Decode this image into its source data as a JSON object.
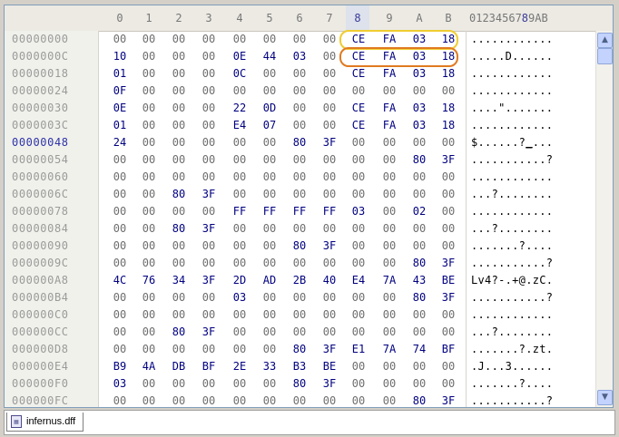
{
  "columns": [
    "0",
    "1",
    "2",
    "3",
    "4",
    "5",
    "6",
    "7",
    "8",
    "9",
    "A",
    "B"
  ],
  "ascii_header_pre": "01234567",
  "ascii_header_hl": "8",
  "ascii_header_post": "9AB",
  "selected_column": "8",
  "current_address": "00000048",
  "rows": [
    {
      "addr": "00000000",
      "bytes": [
        "00",
        "00",
        "00",
        "00",
        "00",
        "00",
        "00",
        "00",
        "CE",
        "FA",
        "03",
        "18"
      ],
      "ascii": "............"
    },
    {
      "addr": "0000000C",
      "bytes": [
        "10",
        "00",
        "00",
        "00",
        "0E",
        "44",
        "03",
        "00",
        "CE",
        "FA",
        "03",
        "18"
      ],
      "ascii": ".....D......"
    },
    {
      "addr": "00000018",
      "bytes": [
        "01",
        "00",
        "00",
        "00",
        "0C",
        "00",
        "00",
        "00",
        "CE",
        "FA",
        "03",
        "18"
      ],
      "ascii": "............"
    },
    {
      "addr": "00000024",
      "bytes": [
        "0F",
        "00",
        "00",
        "00",
        "00",
        "00",
        "00",
        "00",
        "00",
        "00",
        "00",
        "00"
      ],
      "ascii": "............"
    },
    {
      "addr": "00000030",
      "bytes": [
        "0E",
        "00",
        "00",
        "00",
        "22",
        "0D",
        "00",
        "00",
        "CE",
        "FA",
        "03",
        "18"
      ],
      "ascii": "....\"......."
    },
    {
      "addr": "0000003C",
      "bytes": [
        "01",
        "00",
        "00",
        "00",
        "E4",
        "07",
        "00",
        "00",
        "CE",
        "FA",
        "03",
        "18"
      ],
      "ascii": "............"
    },
    {
      "addr": "00000048",
      "bytes": [
        "24",
        "00",
        "00",
        "00",
        "00",
        "00",
        "80",
        "3F",
        "00",
        "00",
        "00",
        "00"
      ],
      "ascii": "$......?",
      "ascii_caret": "_",
      "ascii_post": "..."
    },
    {
      "addr": "00000054",
      "bytes": [
        "00",
        "00",
        "00",
        "00",
        "00",
        "00",
        "00",
        "00",
        "00",
        "00",
        "80",
        "3F"
      ],
      "ascii": "...........?"
    },
    {
      "addr": "00000060",
      "bytes": [
        "00",
        "00",
        "00",
        "00",
        "00",
        "00",
        "00",
        "00",
        "00",
        "00",
        "00",
        "00"
      ],
      "ascii": "............"
    },
    {
      "addr": "0000006C",
      "bytes": [
        "00",
        "00",
        "80",
        "3F",
        "00",
        "00",
        "00",
        "00",
        "00",
        "00",
        "00",
        "00"
      ],
      "ascii": "...?........"
    },
    {
      "addr": "00000078",
      "bytes": [
        "00",
        "00",
        "00",
        "00",
        "FF",
        "FF",
        "FF",
        "FF",
        "03",
        "00",
        "02",
        "00"
      ],
      "ascii": "............"
    },
    {
      "addr": "00000084",
      "bytes": [
        "00",
        "00",
        "80",
        "3F",
        "00",
        "00",
        "00",
        "00",
        "00",
        "00",
        "00",
        "00"
      ],
      "ascii": "...?........"
    },
    {
      "addr": "00000090",
      "bytes": [
        "00",
        "00",
        "00",
        "00",
        "00",
        "00",
        "80",
        "3F",
        "00",
        "00",
        "00",
        "00"
      ],
      "ascii": ".......?...."
    },
    {
      "addr": "0000009C",
      "bytes": [
        "00",
        "00",
        "00",
        "00",
        "00",
        "00",
        "00",
        "00",
        "00",
        "00",
        "80",
        "3F"
      ],
      "ascii": "...........?"
    },
    {
      "addr": "000000A8",
      "bytes": [
        "4C",
        "76",
        "34",
        "3F",
        "2D",
        "AD",
        "2B",
        "40",
        "E4",
        "7A",
        "43",
        "BE"
      ],
      "ascii": "Lv4?-.+@.zC."
    },
    {
      "addr": "000000B4",
      "bytes": [
        "00",
        "00",
        "00",
        "00",
        "03",
        "00",
        "00",
        "00",
        "00",
        "00",
        "80",
        "3F"
      ],
      "ascii": "...........?"
    },
    {
      "addr": "000000C0",
      "bytes": [
        "00",
        "00",
        "00",
        "00",
        "00",
        "00",
        "00",
        "00",
        "00",
        "00",
        "00",
        "00"
      ],
      "ascii": "............"
    },
    {
      "addr": "000000CC",
      "bytes": [
        "00",
        "00",
        "80",
        "3F",
        "00",
        "00",
        "00",
        "00",
        "00",
        "00",
        "00",
        "00"
      ],
      "ascii": "...?........"
    },
    {
      "addr": "000000D8",
      "bytes": [
        "00",
        "00",
        "00",
        "00",
        "00",
        "00",
        "80",
        "3F",
        "E1",
        "7A",
        "74",
        "BF"
      ],
      "ascii": ".......?.zt."
    },
    {
      "addr": "000000E4",
      "bytes": [
        "B9",
        "4A",
        "DB",
        "BF",
        "2E",
        "33",
        "B3",
        "BE",
        "00",
        "00",
        "00",
        "00"
      ],
      "ascii": ".J...3......"
    },
    {
      "addr": "000000F0",
      "bytes": [
        "03",
        "00",
        "00",
        "00",
        "00",
        "00",
        "80",
        "3F",
        "00",
        "00",
        "00",
        "00"
      ],
      "ascii": ".......?...."
    },
    {
      "addr": "000000FC",
      "bytes": [
        "00",
        "00",
        "00",
        "00",
        "00",
        "00",
        "00",
        "00",
        "00",
        "00",
        "80",
        "3F"
      ],
      "ascii": "...........?"
    }
  ],
  "scrollbar": {
    "up_glyph": "▲",
    "down_glyph": "▼"
  },
  "tab": {
    "label": "infernus.dff"
  },
  "colors": {
    "highlight_oval_1": "#f0cc30",
    "highlight_oval_2": "#e07a20",
    "byte_text": "#000080",
    "current_address": "#2d34a8"
  }
}
